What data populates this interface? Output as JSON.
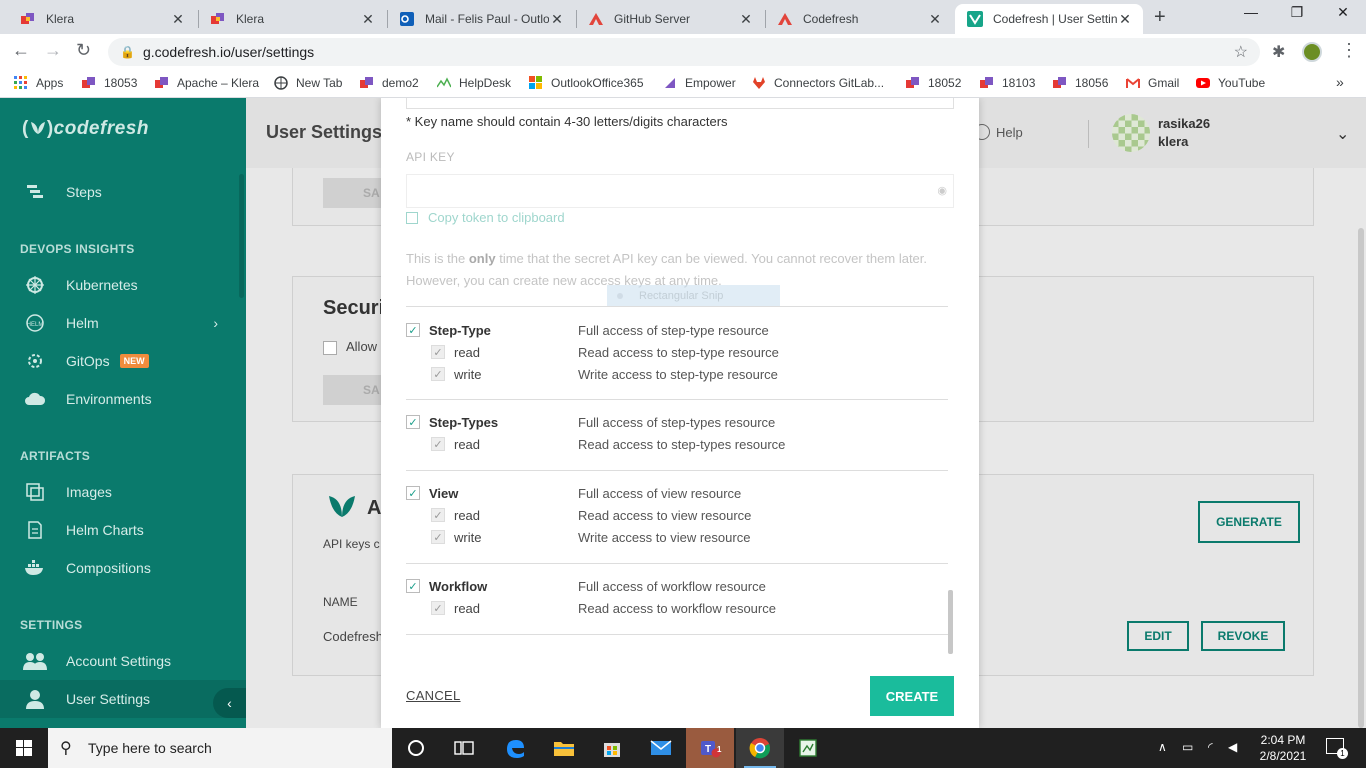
{
  "browser": {
    "tabs": [
      {
        "title": "Klera",
        "favicon": "klera-icon"
      },
      {
        "title": "Klera",
        "favicon": "klera-icon"
      },
      {
        "title": "Mail - Felis Paul - Outlo",
        "favicon": "outlook-icon"
      },
      {
        "title": "GitHub Server",
        "favicon": "github-server-icon"
      },
      {
        "title": "Codefresh",
        "favicon": "codefresh-icon"
      },
      {
        "title": "Codefresh | User Setting",
        "favicon": "codefresh-icon",
        "active": true
      }
    ],
    "url": "g.codefresh.io/user/settings",
    "bookmarks": [
      "Apps",
      "18053",
      "Apache – Klera",
      "New Tab",
      "demo2",
      "HelpDesk",
      "OutlookOffice365",
      "Empower",
      "Connectors GitLab...",
      "18052",
      "18103",
      "18056",
      "Gmail",
      "YouTube"
    ]
  },
  "sidebar": {
    "logo": {
      "part1": "(",
      "part2": ")",
      "name": "codefresh"
    },
    "steps": "Steps",
    "section_devops": "DEVOPS INSIGHTS",
    "kubernetes": "Kubernetes",
    "helm": "Helm",
    "gitops": "GitOps",
    "gitops_badge": "NEW",
    "environments": "Environments",
    "section_artifacts": "ARTIFACTS",
    "images": "Images",
    "helm_charts": "Helm Charts",
    "compositions": "Compositions",
    "section_settings": "SETTINGS",
    "account_settings": "Account Settings",
    "user_settings": "User Settings"
  },
  "header": {
    "title": "User Settings",
    "help": "Help",
    "username": "rasika26",
    "account": "klera"
  },
  "background": {
    "save_1": "SA",
    "security_title": "Securi",
    "allow": "Allow",
    "save_2": "SA",
    "api_title": "A",
    "api_desc": "API keys c",
    "name_col": "NAME",
    "row_name": "Codefresh",
    "generate": "GENERATE",
    "edit": "EDIT",
    "revoke": "REVOKE"
  },
  "modal": {
    "key_note": "* Key name should contain 4-30 letters/digits characters",
    "api_key_label": "API KEY",
    "api_key_value": "",
    "copy_token": "Copy token to clipboard",
    "info_part1": "This is the ",
    "info_bold": "only",
    "info_part2": " time that the secret API key can be viewed. You cannot recover them later. However, you can create new access keys at any time.",
    "snip_label": "Rectangular Snip",
    "permissions": [
      {
        "name": "Step-Type",
        "desc": "Full access of step-type resource",
        "children": [
          {
            "name": "read",
            "desc": "Read access to step-type resource"
          },
          {
            "name": "write",
            "desc": "Write access to step-type resource"
          }
        ]
      },
      {
        "name": "Step-Types",
        "desc": "Full access of step-types resource",
        "children": [
          {
            "name": "read",
            "desc": "Read access to step-types resource"
          }
        ]
      },
      {
        "name": "View",
        "desc": "Full access of view resource",
        "children": [
          {
            "name": "read",
            "desc": "Read access to view resource"
          },
          {
            "name": "write",
            "desc": "Write access to view resource"
          }
        ]
      },
      {
        "name": "Workflow",
        "desc": "Full access of workflow resource",
        "children": [
          {
            "name": "read",
            "desc": "Read access to workflow resource"
          }
        ]
      }
    ],
    "check": "✓",
    "cancel": "CANCEL",
    "create": "CREATE"
  },
  "taskbar": {
    "search_placeholder": "Type here to search",
    "time": "2:04 PM",
    "date": "2/8/2021",
    "teams_badge": "1",
    "notif_count": "1"
  },
  "colors": {
    "brand": "#0a7a6c",
    "accent": "#1abc9c"
  }
}
